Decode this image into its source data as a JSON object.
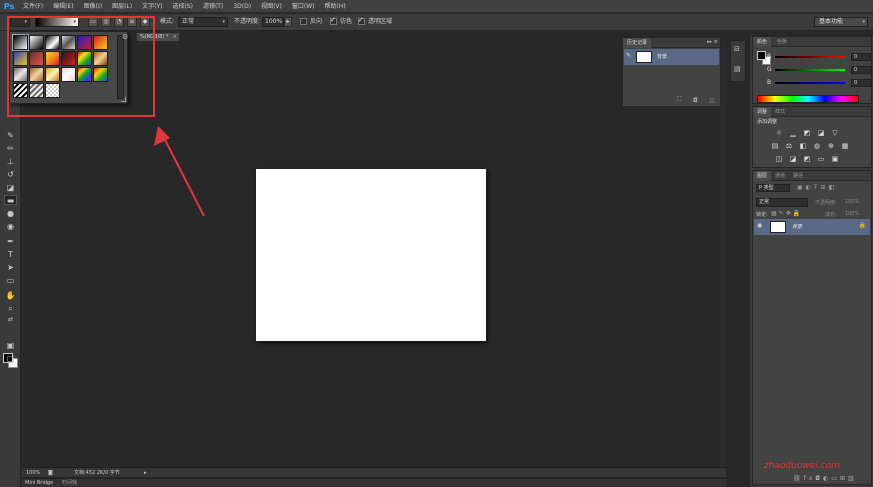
{
  "app": {
    "logo": "Ps"
  },
  "menu": [
    "文件(F)",
    "编辑(E)",
    "图像(I)",
    "图层(L)",
    "文字(Y)",
    "选择(S)",
    "滤镜(T)",
    "3D(D)",
    "视图(V)",
    "窗口(W)",
    "帮助(H)"
  ],
  "options": {
    "mode_label": "模式:",
    "mode_value": "正常",
    "opacity_label": "不透明度:",
    "opacity_value": "100%",
    "reverse_label": "反向",
    "dither_label": "仿色",
    "transparency_label": "透明区域",
    "workspace": "基本功能"
  },
  "document": {
    "tab_title": "%(RGB/8) *"
  },
  "gradient_presets": {
    "swatches": [
      "linear-gradient(135deg,#000,#fff)",
      "linear-gradient(135deg,#fff,#000)",
      "linear-gradient(135deg,#000,#fff 60%,#000)",
      "linear-gradient(135deg,#ddd,#555,#ddd)",
      "linear-gradient(135deg,#1c1ec8,#d21e2c)",
      "linear-gradient(135deg,#e01b22,#f7d11a)",
      "linear-gradient(135deg,#2c43c7,#f2c61a)",
      "linear-gradient(135deg,#6b2d2a,#e2574c)",
      "linear-gradient(135deg,#f2d31c,#f08a1c,#e01b22)",
      "linear-gradient(135deg,#1a1a1a,#d91f23)",
      "linear-gradient(135deg,#d61a1a,#f5e21a,#1aa31a,#1a52d6)",
      "linear-gradient(135deg,#b05a1a,#f0d090,#8a3a10)",
      "linear-gradient(135deg,#6a6a6a,#e8e8e8,#6a6a6a)",
      "linear-gradient(135deg,#a05a20,#f5d0a0,#a05a20)",
      "linear-gradient(135deg,#d8a020,#fff3b0,#c07a10)",
      "linear-gradient(135deg,#f5c3d0,#fff,#f5c3d0)",
      "linear-gradient(135deg,#e01b22,#f7d11a,#1aa31a,#1a52d6,#8a1ac7)",
      "linear-gradient(135deg,#e01b22,#f7d11a,#1aa31a,#1a52d6)",
      "repeating-linear-gradient(135deg,#fff 0 2px,#000 2px 4px)",
      "repeating-linear-gradient(135deg,#eee 0 2px,#666 2px 4px)",
      "repeating-conic-gradient(#ccc 0 25%,#fff 0 50%) 0 0/4px 4px"
    ]
  },
  "status": {
    "zoom": "100%",
    "doc_size": "文档:452.2K/0 字节",
    "mini_bridge": "Mini Bridge",
    "timeline": "时间轴"
  },
  "history": {
    "tab": "历史记录",
    "item": "背景"
  },
  "color_panel": {
    "tab_color": "颜色",
    "tab_swatches": "色板",
    "r_label": "R",
    "g_label": "G",
    "b_label": "B",
    "r_value": "0",
    "g_value": "0",
    "b_value": "0"
  },
  "adjust_panel": {
    "tab_adjust": "调整",
    "tab_styles": "样式",
    "title": "添加调整"
  },
  "layers_panel": {
    "tab_layers": "图层",
    "tab_channels": "通道",
    "tab_paths": "路径",
    "kind_filter": "P 类型",
    "blend_mode": "正常",
    "opacity_label": "不透明度:",
    "opacity_value": "100%",
    "lock_label": "锁定:",
    "fill_label": "填充:",
    "fill_value": "100%",
    "layer_name": "背景"
  },
  "watermark": "zhaoduowei.com"
}
